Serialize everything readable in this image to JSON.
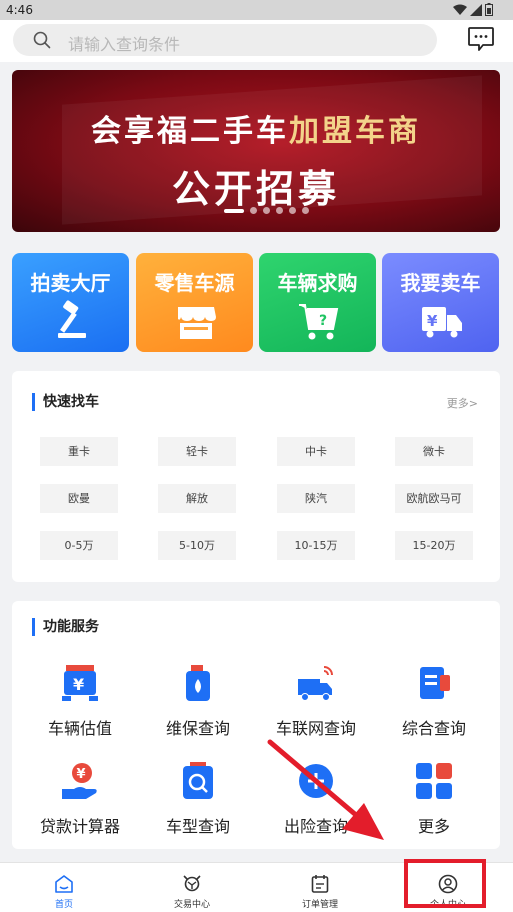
{
  "status_bar": {
    "time": "4:46"
  },
  "search": {
    "placeholder": "请输入查询条件"
  },
  "banner": {
    "line1_white": "会享福二手车",
    "line1_gold": "加盟车商",
    "line2": "公开招募",
    "dots_count": 6,
    "active_dot": 0
  },
  "quick_entries": [
    {
      "label": "拍卖大厅",
      "icon": "gavel-icon",
      "color": "#2a86f8"
    },
    {
      "label": "零售车源",
      "icon": "shop-icon",
      "color": "#ff9d2c"
    },
    {
      "label": "车辆求购",
      "icon": "cart-icon",
      "color": "#1ec462"
    },
    {
      "label": "我要卖车",
      "icon": "truck-yen-icon",
      "color": "#6575f6"
    }
  ],
  "find_car": {
    "title": "快速找车",
    "more": "更多>",
    "chips": [
      [
        "重卡",
        "轻卡",
        "中卡",
        "微卡"
      ],
      [
        "欧曼",
        "解放",
        "陕汽",
        "欧航欧马可"
      ],
      [
        "0-5万",
        "5-10万",
        "10-15万",
        "15-20万"
      ]
    ]
  },
  "services": {
    "title": "功能服务",
    "items": [
      {
        "label": "车辆估值",
        "icon": "truck-value-icon"
      },
      {
        "label": "维保查询",
        "icon": "oil-bottle-icon"
      },
      {
        "label": "车联网查询",
        "icon": "connected-truck-icon"
      },
      {
        "label": "综合查询",
        "icon": "document-icon"
      },
      {
        "label": "贷款计算器",
        "icon": "loan-hand-icon"
      },
      {
        "label": "车型查询",
        "icon": "model-search-icon"
      },
      {
        "label": "出险查询",
        "icon": "insurance-icon"
      },
      {
        "label": "更多",
        "icon": "grid-icon"
      }
    ]
  },
  "tabs": [
    {
      "label": "首页",
      "icon": "home-icon",
      "active": true
    },
    {
      "label": "交易中心",
      "icon": "trade-icon",
      "active": false
    },
    {
      "label": "订单管理",
      "icon": "order-icon",
      "active": false
    },
    {
      "label": "个人中心",
      "icon": "user-icon",
      "active": false
    }
  ],
  "colors": {
    "accent": "#1e6ff5",
    "annotation": "#e31d2b"
  }
}
